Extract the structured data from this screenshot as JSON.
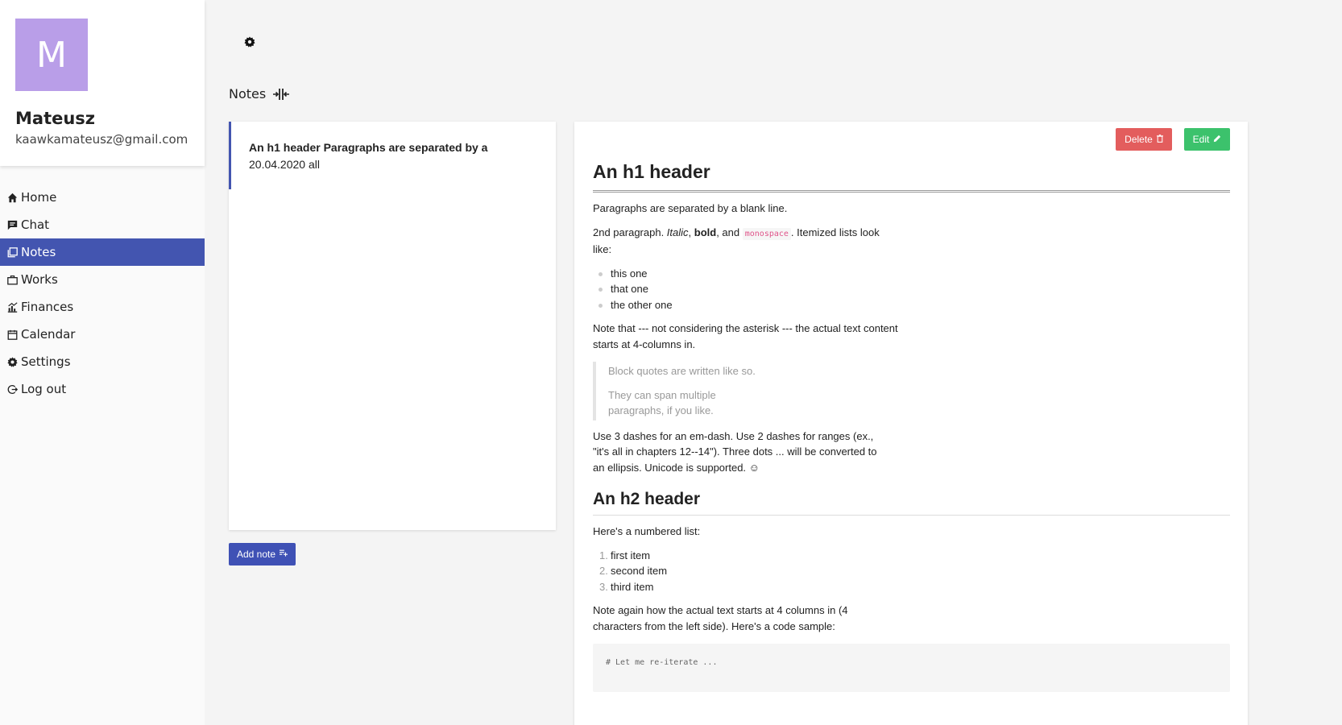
{
  "profile": {
    "avatar_letter": "M",
    "name": "Mateusz",
    "email": "kaawkamateusz@gmail.com"
  },
  "nav": {
    "items": [
      {
        "label": "Home",
        "icon": "home-icon"
      },
      {
        "label": "Chat",
        "icon": "chat-icon"
      },
      {
        "label": "Notes",
        "icon": "notes-icon",
        "active": true
      },
      {
        "label": "Works",
        "icon": "briefcase-icon"
      },
      {
        "label": "Finances",
        "icon": "chart-icon"
      },
      {
        "label": "Calendar",
        "icon": "calendar-icon"
      },
      {
        "label": "Settings",
        "icon": "gear-icon"
      },
      {
        "label": "Log out",
        "icon": "logout-icon"
      }
    ]
  },
  "notes_section": {
    "heading": "Notes",
    "add_note_label": "Add note"
  },
  "note_list": [
    {
      "title": "An h1 header Paragraphs are separated by a",
      "date": "20.04.2020 all"
    }
  ],
  "note_view": {
    "delete_label": "Delete",
    "edit_label": "Edit",
    "h1": "An h1 header",
    "p1": "Paragraphs are separated by a blank line.",
    "p2_start": "2nd paragraph. ",
    "p2_italic": "Italic",
    "p2_sep1": ", ",
    "p2_bold": "bold",
    "p2_sep2": ", and ",
    "p2_code": "monospace",
    "p2_end": ". Itemized lists look like:",
    "bullets": [
      "this one",
      "that one",
      "the other one"
    ],
    "p3": "Note that --- not considering the asterisk --- the actual text content starts at 4-columns in.",
    "quote1": "Block quotes are written like so.",
    "quote2": "They can span multiple paragraphs, if you like.",
    "p4": "Use 3 dashes for an em-dash. Use 2 dashes for ranges (ex., \"it's all in chapters 12--14\"). Three dots ... will be converted to an ellipsis. Unicode is supported. ☺",
    "h2": "An h2 header",
    "p5": "Here's a numbered list:",
    "numbered": [
      "first item",
      "second item",
      "third item"
    ],
    "p6": "Note again how the actual text starts at 4 columns in (4 characters from the left side). Here's a code sample:",
    "code": "# Let me re-iterate ..."
  }
}
